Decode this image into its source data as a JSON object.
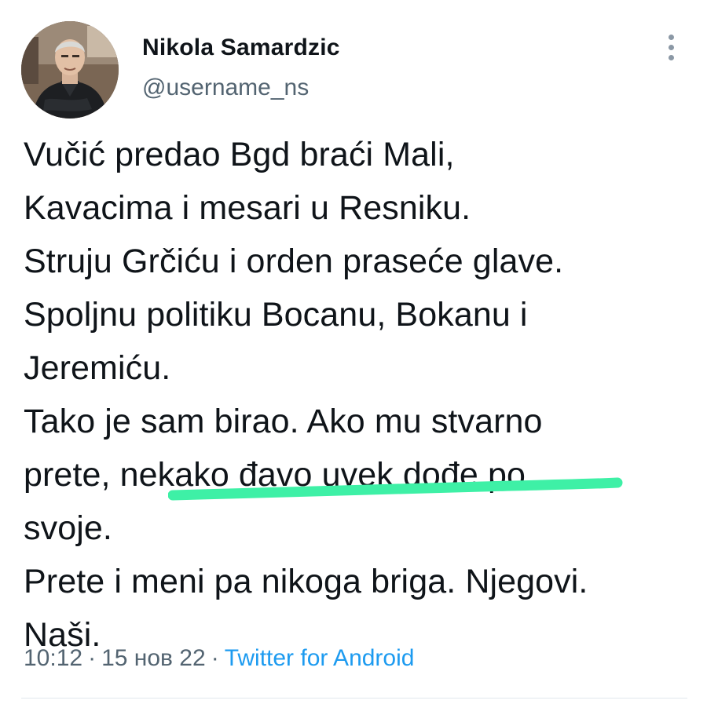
{
  "author": {
    "display_name": "Nikola Samardzic",
    "handle": "@username_ns"
  },
  "tweet": {
    "lines": [
      "Vučić predao Bgd braći Mali,",
      "Kavacima i mesari u Resniku.",
      "Struju Grčiću i orden praseće glave.",
      "Spoljnu politiku Bocanu, Bokanu i",
      "Jeremiću.",
      "Tako je sam birao. Ako mu stvarno",
      "prete, nekako đavo uvek dođe po",
      "svoje.",
      "Prete i meni pa nikoga briga. Njegovi.",
      "Naši."
    ]
  },
  "meta": {
    "time": "10:12",
    "date": "15 нов 22",
    "separator": "·",
    "source": "Twitter for Android"
  },
  "icons": {
    "more": "more-vertical-icon",
    "avatar": "profile-photo"
  },
  "colors": {
    "text": "#0f1419",
    "secondary": "#536471",
    "link": "#1d9bf0",
    "highlight": "#3ef0a6"
  }
}
